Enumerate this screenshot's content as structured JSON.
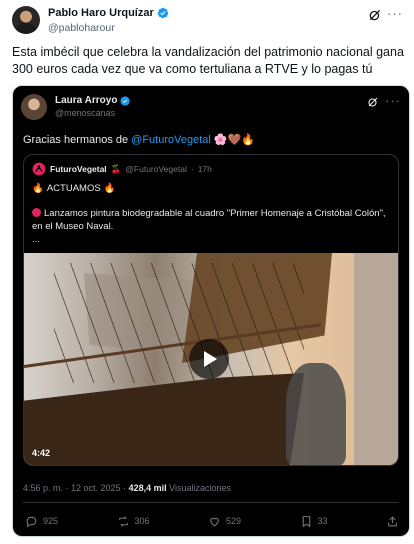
{
  "outer": {
    "author_name": "Pablo Haro Urquízar",
    "author_handle": "@pabloharour",
    "text": "Esta imbécil que celebra la vandalización del patrimonio nacional gana 300 euros cada vez que va como tertuliana a RTVE y lo pagas tú"
  },
  "inner": {
    "author_name": "Laura Arroyo",
    "author_handle": "@menoscanas",
    "text_prefix": "Gracias hermanos de",
    "mention": "@FuturoVegetal",
    "text_emojis": "🌸🤎🔥"
  },
  "quote": {
    "name": "FuturoVegetal",
    "name_emoji": "🍒",
    "handle": "@FuturoVegetal",
    "time": "17h",
    "line1": "ACTUAMOS",
    "line1_emoji": "🔥",
    "line2": "Lanzamos pintura biodegradable al cuadro \"Primer Homenaje a Cristóbal Colón\", en el Museo Naval.",
    "ellipsis": "...",
    "video_duration": "4:42"
  },
  "stamp": {
    "time": "4:56 p. m. · 12 oct. 2025 ·",
    "views_count": "428,4 mil",
    "views_label": "Visualizaciones"
  },
  "actions": {
    "replies": "925",
    "reposts": "306",
    "likes": "529",
    "bookmarks": "33"
  },
  "colors": {
    "accent": "#1d9bf0",
    "dark_bg": "#000000",
    "muted": "#71767b"
  }
}
